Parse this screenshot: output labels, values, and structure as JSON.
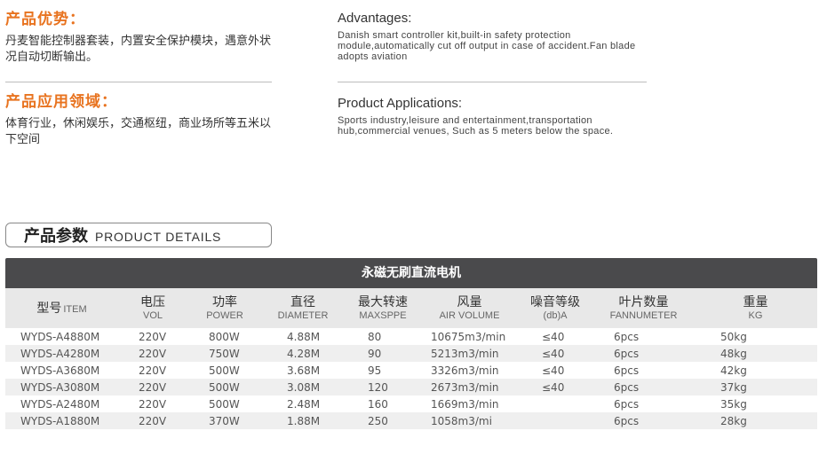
{
  "advantages": {
    "zh_title": "产品优势：",
    "zh_text": "丹麦智能控制器套装，内置安全保护模块，遇意外状况自动切断输出。",
    "en_title": "Advantages:",
    "en_text": "Danish smart controller kit,built-in safety protection module,automatically cut off output in case of accident.Fan blade adopts aviation"
  },
  "applications": {
    "zh_title": "产品应用领域：",
    "zh_text": "体育行业，休闲娱乐，交通枢纽，商业场所等五米以下空间",
    "en_title": "Product Applications:",
    "en_text": "Sports industry,leisure and entertainment,transportation hub,commercial venues, Such as 5 meters below the space."
  },
  "details": {
    "zh": "产品参数",
    "en": "PRODUCT DETAILS"
  },
  "table": {
    "caption": "永磁无刷直流电机",
    "columns": [
      {
        "zh": "型号",
        "en": "ITEM"
      },
      {
        "zh": "电压",
        "en": "VOL"
      },
      {
        "zh": "功率",
        "en": "POWER"
      },
      {
        "zh": "直径",
        "en": "DIAMETER"
      },
      {
        "zh": "最大转速",
        "en": "MAXSPPE"
      },
      {
        "zh": "风量",
        "en": "AIR VOLUME"
      },
      {
        "zh": "噪音等级",
        "en": "(db)A"
      },
      {
        "zh": "叶片数量",
        "en": "FANNUMETER"
      },
      {
        "zh": "重量",
        "en": "KG"
      }
    ],
    "rows": [
      [
        "WYDS-A4880M",
        "220V",
        "800W",
        "4.88M",
        "80",
        "10675m3/min",
        "≤40",
        "6pcs",
        "50kg"
      ],
      [
        "WYDS-A4280M",
        "220V",
        "750W",
        "4.28M",
        "90",
        "5213m3/min",
        "≤40",
        "6pcs",
        "48kg"
      ],
      [
        "WYDS-A3680M",
        "220V",
        "500W",
        "3.68M",
        "95",
        "3326m3/min",
        "≤40",
        "6pcs",
        "42kg"
      ],
      [
        "WYDS-A3080M",
        "220V",
        "500W",
        "3.08M",
        "120",
        "2673m3/min",
        "≤40",
        "6pcs",
        "37kg"
      ],
      [
        "WYDS-A2480M",
        "220V",
        "500W",
        "2.48M",
        "160",
        "1669m3/min",
        "",
        "6pcs",
        "35kg"
      ],
      [
        "WYDS-A1880M",
        "220V",
        "370W",
        "1.88M",
        "250",
        "1058m3/mi",
        "",
        "6pcs",
        "28kg"
      ]
    ]
  }
}
